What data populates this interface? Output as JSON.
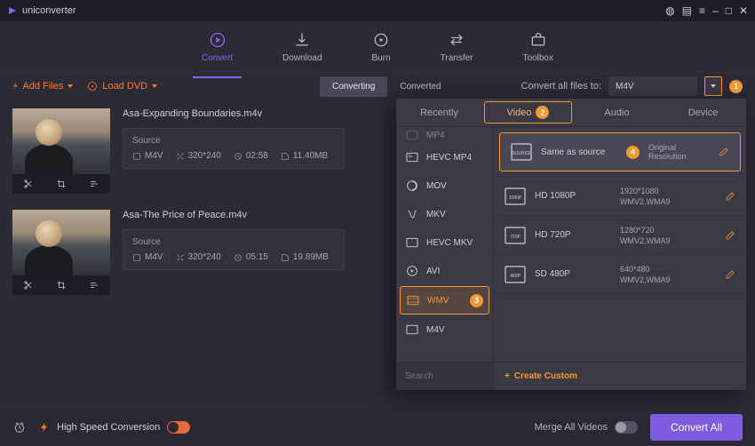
{
  "app_name": "uniconverter",
  "main_nav": {
    "convert": "Convert",
    "download": "Download",
    "burn": "Burn",
    "transfer": "Transfer",
    "toolbox": "Toolbox"
  },
  "topbar": {
    "add_files": "Add Files",
    "load_dvd": "Load DVD",
    "converting": "Converting",
    "converted": "Converted",
    "convert_all_to": "Convert all files to:",
    "selected_fmt": "M4V"
  },
  "badges": {
    "one": "1",
    "two": "2",
    "three": "3",
    "four": "4"
  },
  "files": [
    {
      "name": "Asa-Expanding Boundaries.m4v",
      "source": "Source",
      "fmt": "M4V",
      "res": "320*240",
      "dur": "02:58",
      "size": "11.40MB"
    },
    {
      "name": "Asa-The Price of Peace.m4v",
      "source": "Source",
      "fmt": "M4V",
      "res": "320*240",
      "dur": "05:15",
      "size": "19.89MB"
    }
  ],
  "panel": {
    "tabs": {
      "recently": "Recently",
      "video": "Video",
      "audio": "Audio",
      "device": "Device"
    },
    "formats": [
      "MP4",
      "HEVC MP4",
      "MOV",
      "MKV",
      "HEVC MKV",
      "AVI",
      "WMV",
      "M4V"
    ],
    "resolutions": [
      {
        "name": "Same as source",
        "line1": "Original Resolution",
        "line2": ""
      },
      {
        "name": "HD 1080P",
        "line1": "1920*1080",
        "line2": "WMV2,WMA9"
      },
      {
        "name": "HD 720P",
        "line1": "1280*720",
        "line2": "WMV2,WMA9"
      },
      {
        "name": "SD 480P",
        "line1": "640*480",
        "line2": "WMV2,WMA9"
      }
    ],
    "search_ph": "Search",
    "create_custom": "Create Custom"
  },
  "bottom": {
    "hsc": "High Speed Conversion",
    "merge": "Merge All Videos",
    "convert_all": "Convert All"
  }
}
